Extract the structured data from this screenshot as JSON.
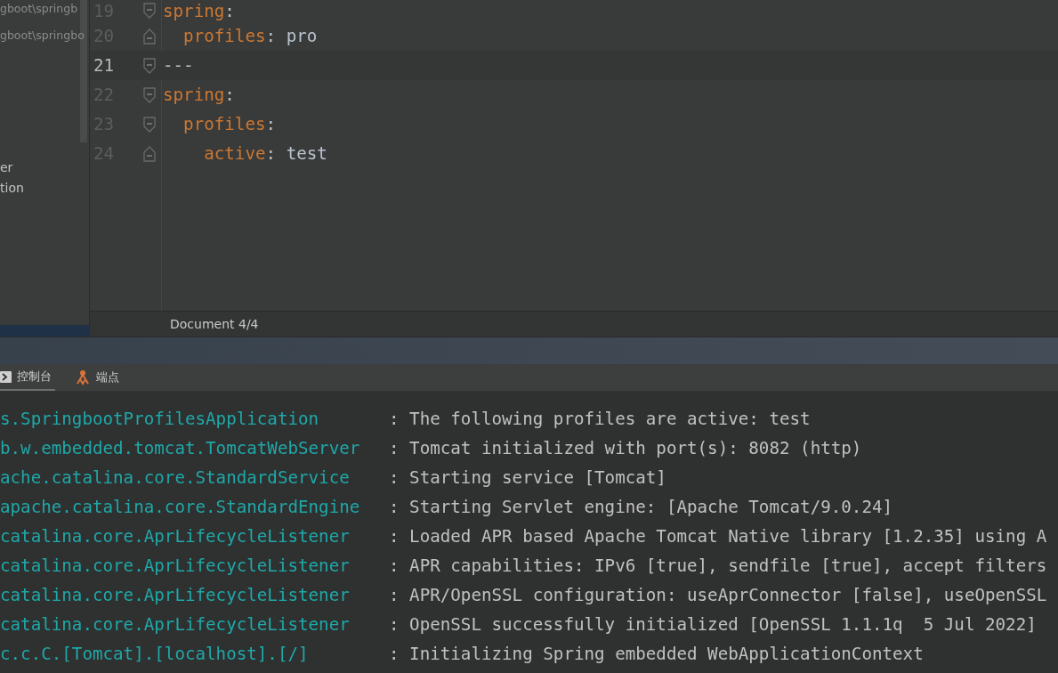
{
  "project_panel": {
    "items": [
      "gboot\\springb",
      "gboot\\springbo",
      "er",
      "tion"
    ]
  },
  "editor": {
    "lines": [
      {
        "number": "19",
        "current": false,
        "kind": "fold_start",
        "tokens": [
          {
            "kind": "key",
            "text": "spring"
          },
          {
            "kind": "punct",
            "text": ":"
          }
        ]
      },
      {
        "number": "20",
        "current": false,
        "kind": "fold_end",
        "tokens": [
          {
            "kind": "key",
            "text": "  profiles"
          },
          {
            "kind": "punct",
            "text": ": "
          },
          {
            "kind": "value",
            "text": "pro"
          }
        ]
      },
      {
        "number": "21",
        "current": true,
        "kind": "fold_start",
        "tokens": [
          {
            "kind": "punct",
            "text": "---"
          }
        ]
      },
      {
        "number": "22",
        "current": false,
        "kind": "fold_start",
        "tokens": [
          {
            "kind": "key",
            "text": "spring"
          },
          {
            "kind": "punct",
            "text": ":"
          }
        ]
      },
      {
        "number": "23",
        "current": false,
        "kind": "fold_start",
        "tokens": [
          {
            "kind": "key",
            "text": "  profiles"
          },
          {
            "kind": "punct",
            "text": ":"
          }
        ]
      },
      {
        "number": "24",
        "current": false,
        "kind": "fold_end",
        "tokens": [
          {
            "kind": "key",
            "text": "    active"
          },
          {
            "kind": "punct",
            "text": ": "
          },
          {
            "kind": "value",
            "text": "test"
          }
        ]
      }
    ]
  },
  "status_bar": {
    "text": "Document 4/4"
  },
  "tool_tabs": [
    {
      "label": "控制台",
      "kind": "terminal",
      "selected": true
    },
    {
      "label": "端点",
      "kind": "endpoints",
      "selected": false
    }
  ],
  "console": {
    "rows": [
      {
        "logger": "s.SpringbootProfilesApplication",
        "message": ": The following profiles are active: test"
      },
      {
        "logger": "b.w.embedded.tomcat.TomcatWebServer",
        "message": ": Tomcat initialized with port(s): 8082 (http)"
      },
      {
        "logger": "ache.catalina.core.StandardService",
        "message": ": Starting service [Tomcat]"
      },
      {
        "logger": "apache.catalina.core.StandardEngine",
        "message": ": Starting Servlet engine: [Apache Tomcat/9.0.24]"
      },
      {
        "logger": "catalina.core.AprLifecycleListener",
        "message": ": Loaded APR based Apache Tomcat Native library [1.2.35] using A"
      },
      {
        "logger": "catalina.core.AprLifecycleListener",
        "message": ": APR capabilities: IPv6 [true], sendfile [true], accept filters"
      },
      {
        "logger": "catalina.core.AprLifecycleListener",
        "message": ": APR/OpenSSL configuration: useAprConnector [false], useOpenSSL"
      },
      {
        "logger": "catalina.core.AprLifecycleListener",
        "message": ": OpenSSL successfully initialized [OpenSSL 1.1.1q  5 Jul 2022]"
      },
      {
        "logger": "c.c.C.[Tomcat].[localhost].[/]",
        "message": ": Initializing Spring embedded WebApplicationContext"
      }
    ]
  }
}
